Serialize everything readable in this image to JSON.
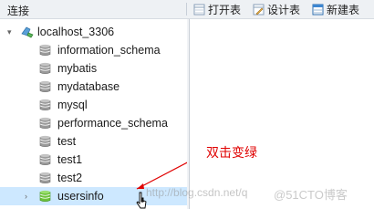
{
  "header": {
    "connection_title": "连接",
    "toolbar": {
      "open_table": "打开表",
      "design_table": "设计表",
      "new_table": "新建表"
    }
  },
  "tree": {
    "connection": {
      "label": "localhost_3306",
      "icon": "mysql-connection-icon"
    },
    "databases": [
      {
        "label": "information_schema",
        "icon": "database-icon"
      },
      {
        "label": "mybatis",
        "icon": "database-icon"
      },
      {
        "label": "mydatabase",
        "icon": "database-icon"
      },
      {
        "label": "mysql",
        "icon": "database-icon"
      },
      {
        "label": "performance_schema",
        "icon": "database-icon"
      },
      {
        "label": "test",
        "icon": "database-icon"
      },
      {
        "label": "test1",
        "icon": "database-icon"
      },
      {
        "label": "test2",
        "icon": "database-icon"
      },
      {
        "label": "usersinfo",
        "icon": "database-open-icon",
        "selected": true
      }
    ]
  },
  "annotation": {
    "text": "双击变绿",
    "color": "#e00000"
  },
  "watermark": {
    "url_text": "http://blog.csdn.net/q",
    "brand_text": "@51CTO博客"
  },
  "colors": {
    "selection": "#cde8ff",
    "db_icon_gray": "#9a9a9a",
    "db_icon_green": "#6cc23a"
  }
}
